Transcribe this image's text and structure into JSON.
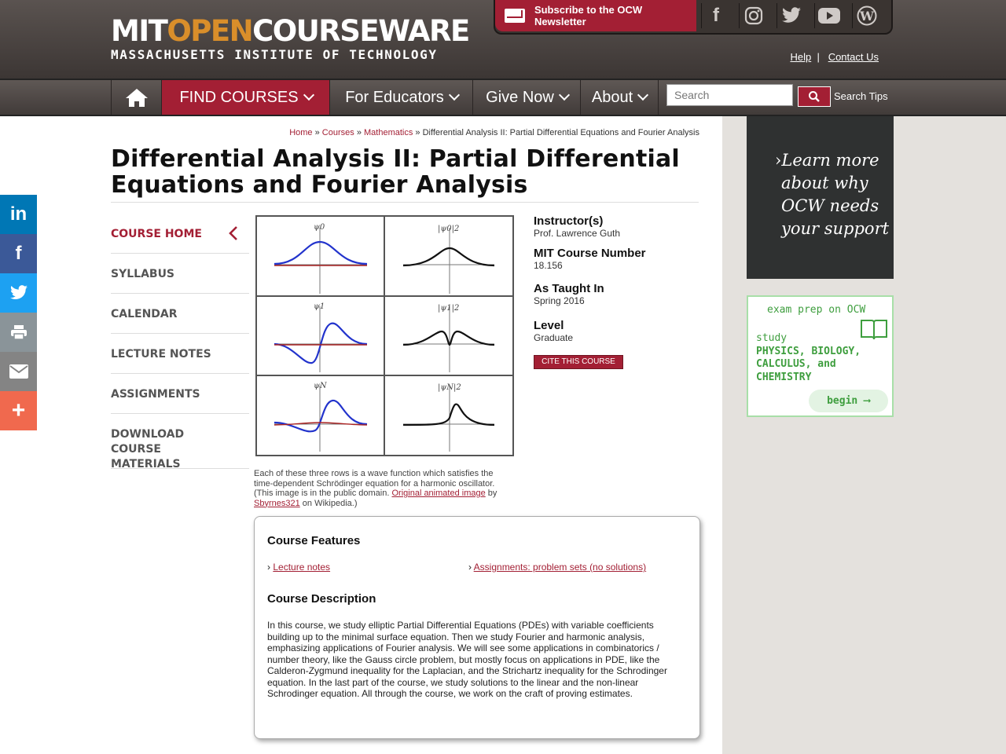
{
  "header": {
    "logo_mit": "MIT",
    "logo_open": "OPEN",
    "logo_courseware": "COURSEWARE",
    "logo_sub": "MASSACHUSETTS INSTITUTE OF TECHNOLOGY",
    "subscribe": "Subscribe to the OCW Newsletter",
    "social": [
      "facebook-icon",
      "instagram-icon",
      "twitter-icon",
      "youtube-icon",
      "wordpress-icon"
    ],
    "help": "Help",
    "contact": "Contact Us"
  },
  "nav": {
    "find_courses": "FIND COURSES",
    "for_educators": "For Educators",
    "give_now": "Give Now",
    "about": "About",
    "search_placeholder": "Search",
    "search_tips": "Search Tips"
  },
  "breadcrumb": {
    "home": "Home",
    "courses": "Courses",
    "mathematics": "Mathematics",
    "sep": "»",
    "current": "Differential Analysis II: Partial Differential Equations and Fourier Analysis"
  },
  "course": {
    "title": "Differential Analysis II: Partial Differential Equations and Fourier Analysis"
  },
  "left_nav": [
    "COURSE HOME",
    "SYLLABUS",
    "CALENDAR",
    "LECTURE NOTES",
    "ASSIGNMENTS",
    "DOWNLOAD COURSE MATERIALS"
  ],
  "figure": {
    "labels": [
      "ψ0",
      "|ψ0|2",
      "ψ1",
      "|ψ1|2",
      "ψN",
      "|ψN|2"
    ],
    "caption_text": "Each of these three rows is a wave function which satisfies the time-dependent Schrödinger equation for a harmonic oscillator. (This image is in the public domain.",
    "caption_link1": "Original animated image",
    "caption_by": "by",
    "caption_link2": "Sbyrnes321",
    "caption_end": "on Wikipedia.)"
  },
  "info": {
    "instructor_label": "Instructor(s)",
    "instructor": "Prof. Lawrence Guth",
    "number_label": "MIT Course Number",
    "number": "18.156",
    "taught_label": "As Taught In",
    "taught": "Spring 2016",
    "level_label": "Level",
    "level": "Graduate",
    "cite": "CITE THIS COURSE"
  },
  "features": {
    "heading": "Course Features",
    "items": [
      "Lecture notes",
      "Assignments: problem sets (no solutions)"
    ],
    "desc_heading": "Course Description",
    "description": "In this course, we study elliptic Partial Differential Equations (PDEs) with variable coefficients building up to the minimal surface equation. Then we study Fourier and harmonic analysis, emphasizing applications of Fourier analysis. We will see some applications in combinatorics / number theory, like the Gauss circle problem, but mostly focus on applications in PDE, like the Calderon-Zygmund inequality for the Laplacian, and the Strichartz inequality for the Schrodinger equation. In the last part of the course, we study solutions to the linear and the non-linear Schrodinger equation. All through the course, we work on the craft of proving estimates."
  },
  "promo": {
    "chalk": [
      "Learn more",
      "about why",
      "OCW needs",
      "your support"
    ],
    "exam_head": "exam prep on OCW",
    "exam_lines": [
      "study",
      "PHYSICS, BIOLOGY,",
      "CALCULUS, and",
      "CHEMISTRY"
    ],
    "exam_btn": "begin"
  },
  "share": [
    "linkedin-icon",
    "facebook-icon",
    "twitter-icon",
    "print-icon",
    "email-icon",
    "more-icon"
  ],
  "colors": {
    "brand": "#a31f34",
    "header": "#4a4341",
    "promo_green": "#3e9e3e"
  }
}
